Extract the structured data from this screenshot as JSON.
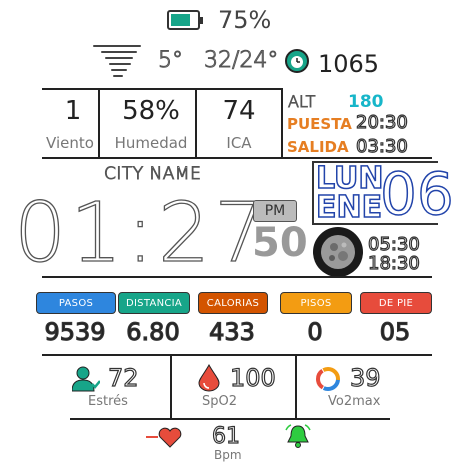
{
  "battery": {
    "percent_text": "75%",
    "level": 0.75,
    "color": "#17a589"
  },
  "weather": {
    "temp": "5°",
    "range": "32/24°"
  },
  "steps_goal": {
    "value": "1065"
  },
  "stats": [
    {
      "value": "1",
      "label": "Viento"
    },
    {
      "value": "58%",
      "label": "Humedad"
    },
    {
      "value": "74",
      "label": "ICA"
    }
  ],
  "astro": {
    "alt_label": "ALT",
    "alt_value": "180",
    "sunset_label": "PUESTA",
    "sunset_value": "20:30",
    "sunrise_label": "SALIDA",
    "sunrise_value": "03:30",
    "alt_color": "#17b6c9",
    "label_color": "#e67e22"
  },
  "clock": {
    "city": "CITY NAME",
    "time": "01:27",
    "ampm": "PM",
    "seconds": "50",
    "day_abbr": "LUN",
    "month_abbr": "ENE",
    "date": "06",
    "time1": "05:30",
    "time2": "18:30"
  },
  "activity": [
    {
      "label": "PASOS",
      "value": "9539",
      "color": "#2e86de"
    },
    {
      "label": "DISTANCIA",
      "value": "6.80",
      "color": "#17a589"
    },
    {
      "label": "CALORIAS",
      "value": "433",
      "color": "#d35400"
    },
    {
      "label": "PISOS",
      "value": "0",
      "color": "#f39c12"
    },
    {
      "label": "DE PIE",
      "value": "05",
      "color": "#e74c3c"
    }
  ],
  "health": [
    {
      "value": "72",
      "label": "Estrés",
      "icon": "person-icon",
      "color": "#17a589"
    },
    {
      "value": "100",
      "label": "SpO2",
      "icon": "blood-drop-icon",
      "color": "#e74c3c"
    },
    {
      "value": "39",
      "label": "Vo2max",
      "icon": "ring-icon",
      "color": "#2e86de"
    }
  ],
  "heart": {
    "value": "61",
    "unit": "Bpm",
    "heart_color": "#e74c3c",
    "bell_color": "#2ecc40"
  }
}
